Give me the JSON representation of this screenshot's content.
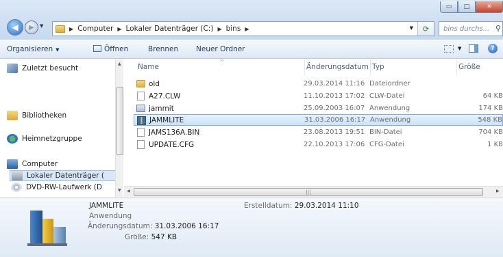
{
  "window": {
    "buttons": {
      "minimize": "▭",
      "maximize": "□",
      "close": "✕"
    }
  },
  "address": {
    "crumbs": [
      "Computer",
      "Lokaler Datenträger (C:)",
      "bins"
    ],
    "search_placeholder": "bins durchs..."
  },
  "toolbar": {
    "organize": "Organisieren",
    "open": "Öffnen",
    "burn": "Brennen",
    "new_folder": "Neuer Ordner"
  },
  "nav": {
    "items": [
      {
        "label": "Zuletzt besucht",
        "icon": "recent-places-icon"
      },
      {
        "label": "Bibliotheken",
        "icon": "libraries-icon"
      },
      {
        "label": "Heimnetzgruppe",
        "icon": "homegroup-icon"
      },
      {
        "label": "Computer",
        "icon": "computer-icon"
      },
      {
        "label": "Lokaler Datenträger (",
        "icon": "drive-icon"
      },
      {
        "label": "DVD-RW-Laufwerk (D",
        "icon": "dvd-icon"
      }
    ]
  },
  "columns": {
    "name": "Name",
    "date": "Änderungsdatum",
    "type": "Typ",
    "size": "Größe"
  },
  "files": [
    {
      "name": "old",
      "date": "29.03.2014 11:16",
      "type": "Dateiordner",
      "size": "",
      "icon": "folder-icon"
    },
    {
      "name": "A27.CLW",
      "date": "11.10.2013 17:02",
      "type": "CLW-Datei",
      "size": "64 KB",
      "icon": "file-icon"
    },
    {
      "name": "jammit",
      "date": "25.09.2003 16:07",
      "type": "Anwendung",
      "size": "174 KB",
      "icon": "app-icon"
    },
    {
      "name": "JAMMLITE",
      "date": "31.03.2006 16:17",
      "type": "Anwendung",
      "size": "548 KB",
      "icon": "jammlite-icon"
    },
    {
      "name": "JAMS136A.BIN",
      "date": "23.08.2013 19:51",
      "type": "BIN-Datei",
      "size": "704 KB",
      "icon": "file-icon"
    },
    {
      "name": "UPDATE.CFG",
      "date": "22.10.2013 17:06",
      "type": "CFG-Datei",
      "size": "1 KB",
      "icon": "file-icon"
    }
  ],
  "selected_file": "JAMMLITE",
  "details": {
    "name": "JAMMLITE",
    "type": "Anwendung",
    "modified_label": "Änderungsdatum:",
    "modified_value": "31.03.2006 16:17",
    "size_label": "Größe:",
    "size_value": "547 KB",
    "created_label": "Erstelldatum:",
    "created_value": "29.03.2014 11:10"
  },
  "colors": {
    "selection": "#cde3f8",
    "selection_border": "#84acdd",
    "chrome": "#c6d9ee"
  }
}
